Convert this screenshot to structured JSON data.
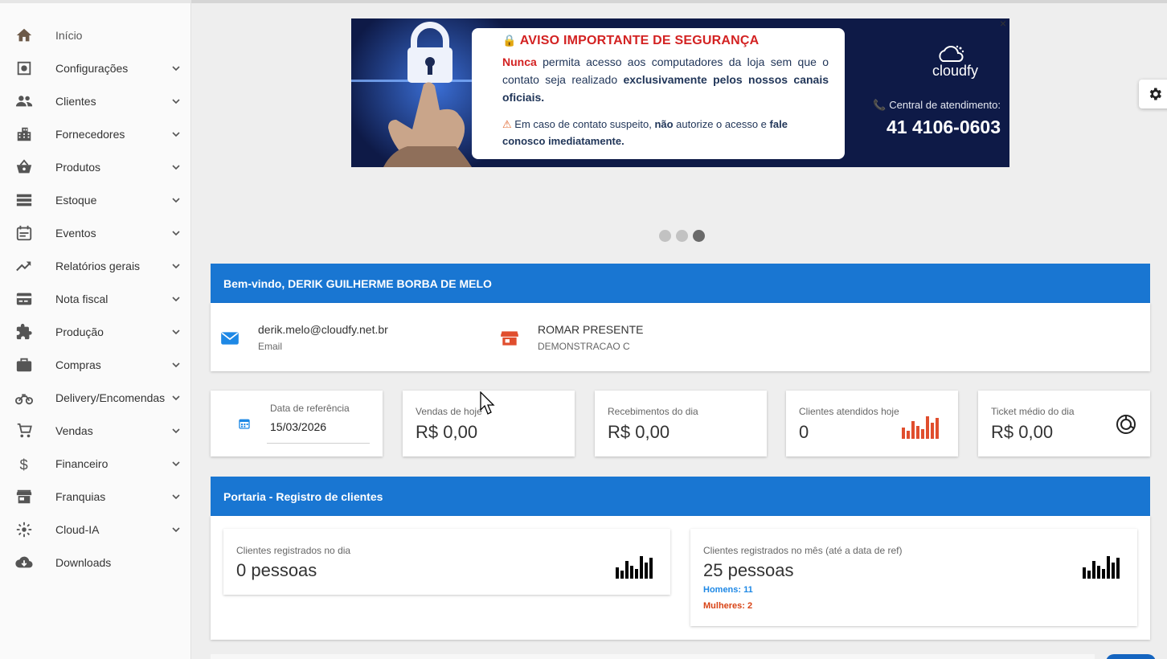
{
  "sidebar": {
    "items": [
      {
        "label": "Início",
        "icon": "home-icon",
        "chevron": false
      },
      {
        "label": "Configurações",
        "icon": "settings-box-icon",
        "chevron": true
      },
      {
        "label": "Clientes",
        "icon": "people-icon",
        "chevron": true
      },
      {
        "label": "Fornecedores",
        "icon": "buildings-icon",
        "chevron": true
      },
      {
        "label": "Produtos",
        "icon": "basket-icon",
        "chevron": true
      },
      {
        "label": "Estoque",
        "icon": "storage-icon",
        "chevron": true
      },
      {
        "label": "Eventos",
        "icon": "calendar-event-icon",
        "chevron": true
      },
      {
        "label": "Relatórios gerais",
        "icon": "trending-up-icon",
        "chevron": true
      },
      {
        "label": "Nota fiscal",
        "icon": "credit-card-icon",
        "chevron": true
      },
      {
        "label": "Produção",
        "icon": "puzzle-icon",
        "chevron": true
      },
      {
        "label": "Compras",
        "icon": "briefcase-icon",
        "chevron": true
      },
      {
        "label": "Delivery/Encomendas",
        "icon": "motorcycle-icon",
        "chevron": true
      },
      {
        "label": "Vendas",
        "icon": "cart-icon",
        "chevron": true
      },
      {
        "label": "Financeiro",
        "icon": "dollar-icon",
        "chevron": true
      },
      {
        "label": "Franquias",
        "icon": "store-icon",
        "chevron": true
      },
      {
        "label": "Cloud-IA",
        "icon": "spark-icon",
        "chevron": true
      },
      {
        "label": "Downloads",
        "icon": "cloud-download-icon",
        "chevron": false
      }
    ]
  },
  "banner": {
    "heading": "AVISO IMPORTANTE DE SEGURANÇA",
    "p1_red": "Nunca",
    "p1_a": " permita acesso aos computadores da loja sem que o contato seja realizado ",
    "p1_b": "exclusivamente pelos nossos canais oficiais.",
    "p2_a": "Em caso de contato suspeito, ",
    "p2_b": "não",
    "p2_c": " autorize o acesso e ",
    "p2_d": "fale conosco imediatamente.",
    "brand": "cloudfy",
    "central_label": "Central de atendimento:",
    "phone": "41 4106-0603",
    "close": "×"
  },
  "carousel": {
    "count": 3,
    "active": 3
  },
  "welcome": {
    "title": "Bem-vindo, DERIK GUILHERME BORBA DE MELO",
    "email": "derik.melo@cloudfy.net.br",
    "email_label": "Email",
    "store": "ROMAR PRESENTE",
    "store_sub": "DEMONSTRACAO C"
  },
  "stats": {
    "date_label": "Data de referência",
    "date_value": "15/03/2026",
    "sales_label": "Vendas de hoje",
    "sales_value": "R$ 0,00",
    "receipts_label": "Recebimentos do dia",
    "receipts_value": "R$ 0,00",
    "clients_label": "Clientes atendidos hoje",
    "clients_value": "0",
    "ticket_label": "Ticket médio do dia",
    "ticket_value": "R$ 0,00"
  },
  "portaria": {
    "title": "Portaria - Registro de clientes",
    "day_label": "Clientes registrados no dia",
    "day_value": "0 pessoas",
    "month_label": "Clientes registrados no mês (até a data de ref)",
    "month_value": "25 pessoas",
    "men": "Homens: 11",
    "women": "Mulheres: 2"
  },
  "colors": {
    "primary": "#1976d2",
    "accent_red": "#e04e2e",
    "banner_bg": "#0e1a47"
  }
}
